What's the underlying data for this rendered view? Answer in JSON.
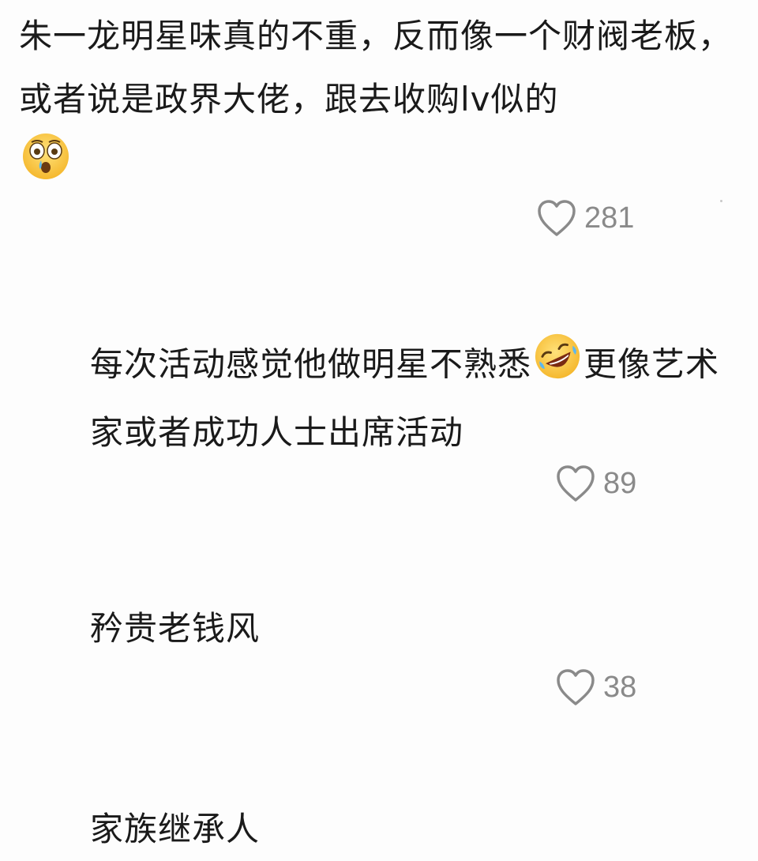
{
  "comments": [
    {
      "text_before": "朱一龙明星味真的不重，反而像一个财阀老板，或者说是政界大佬，跟去收购lv似的",
      "emoji": "flushed-tearful-face-icon",
      "likes": "281"
    }
  ],
  "replies": [
    {
      "text_before": "每次活动感觉他做明星不熟悉",
      "emoji": "rolling-laughing-face-icon",
      "text_after": "更像艺术家或者成功人士出席活动",
      "likes": "89"
    },
    {
      "text": "矜贵老钱风",
      "likes": "38"
    },
    {
      "text": "家族继承人"
    }
  ],
  "colors": {
    "text": "#1a1a1a",
    "muted": "#8a8a8a",
    "background": "#fdfdfd"
  }
}
